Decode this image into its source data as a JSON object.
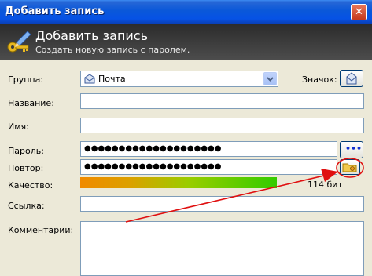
{
  "window": {
    "title": "Добавить запись",
    "close_glyph": "✕"
  },
  "banner": {
    "title": "Добавить запись",
    "subtitle": "Создать новую запись с паролем.",
    "icon": "key-pencil-icon"
  },
  "form": {
    "group_label": "Группа:",
    "group_value": "Почта",
    "icon_label": "Значок:",
    "name_label": "Название:",
    "name_value": "",
    "user_label": "Имя:",
    "user_value": "",
    "password_label": "Пароль:",
    "password_value": "●●●●●●●●●●●●●●●●●●●●",
    "show_password_glyph": "•••",
    "repeat_label": "Повтор:",
    "repeat_value": "●●●●●●●●●●●●●●●●●●●●",
    "quality_label": "Качество:",
    "quality_level": 0.86,
    "quality_bits": "114 бит",
    "url_label": "Ссылка:",
    "url_value": "",
    "comments_label": "Комментарии:",
    "comments_value": ""
  },
  "annotation": {
    "color": "#E01010",
    "shape": "arrow-and-circle"
  }
}
